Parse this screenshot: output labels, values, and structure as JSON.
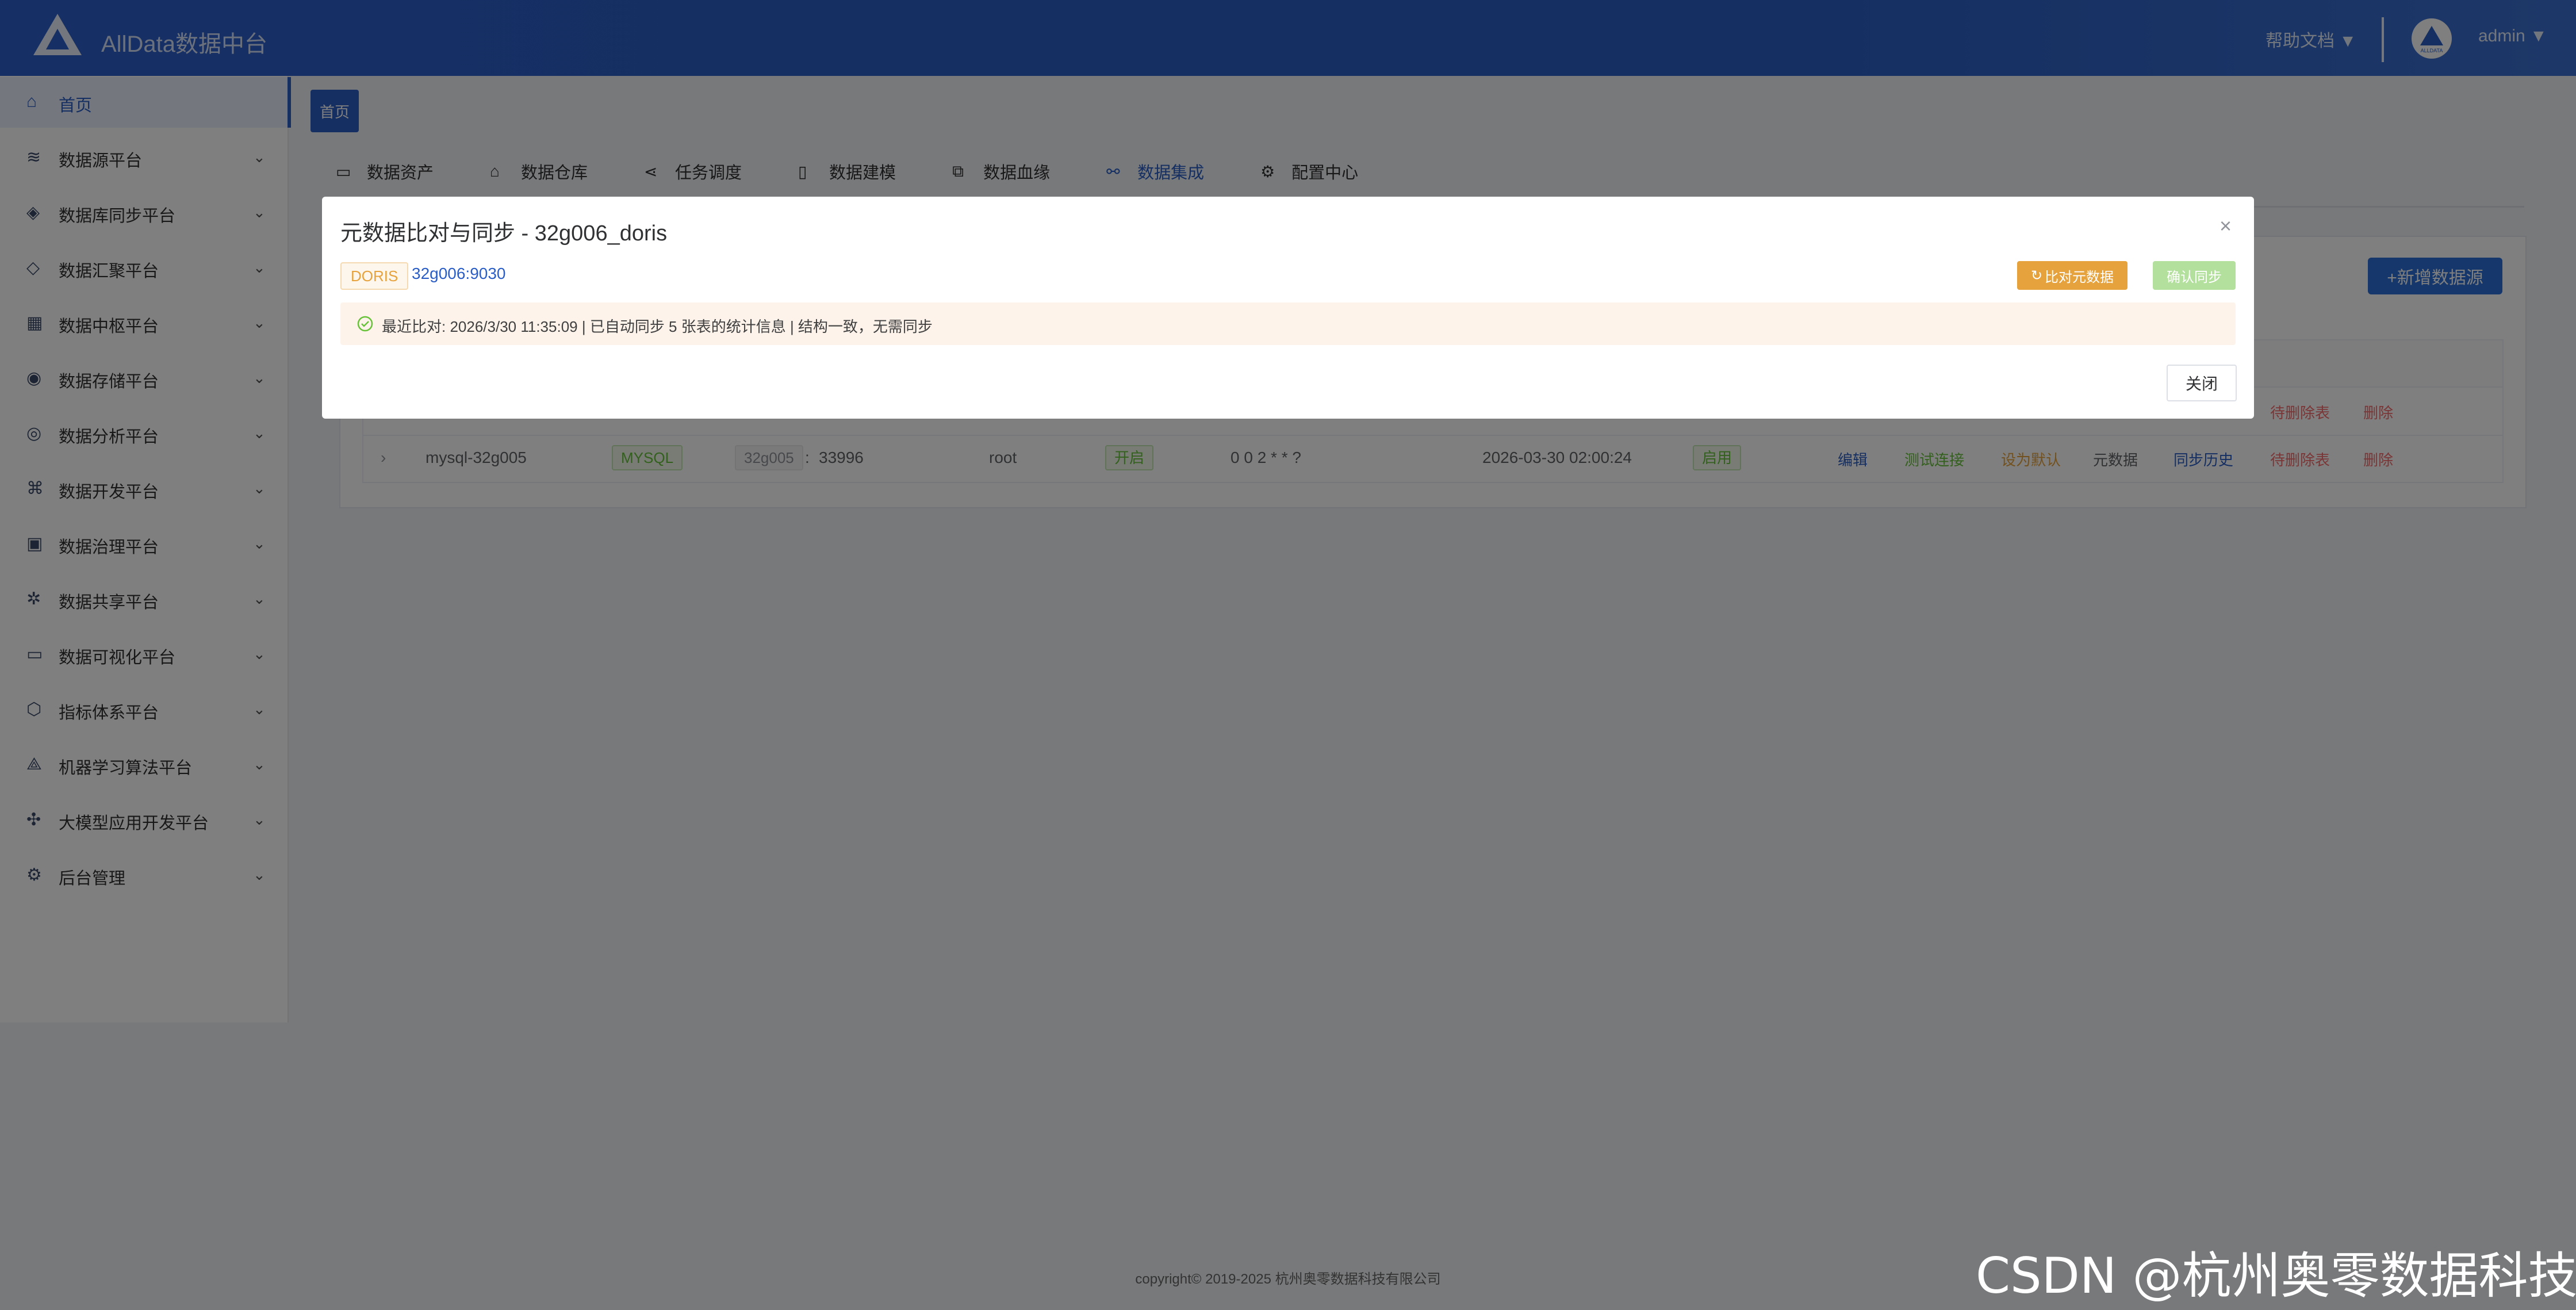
{
  "header": {
    "app_title": "AllData数据中台",
    "help": "帮助文档 ▼",
    "user": "admin ▼",
    "avatar_text": "ALLDATA"
  },
  "sidebar": {
    "items": [
      {
        "label": "首页",
        "icon": "home-icon"
      },
      {
        "label": "数据源平台",
        "icon": "database-icon"
      },
      {
        "label": "数据库同步平台",
        "icon": "shield-sync-icon"
      },
      {
        "label": "数据汇聚平台",
        "icon": "layers-icon"
      },
      {
        "label": "数据中枢平台",
        "icon": "blocks-icon"
      },
      {
        "label": "数据存储平台",
        "icon": "storage-chart-icon"
      },
      {
        "label": "数据分析平台",
        "icon": "analytics-icon"
      },
      {
        "label": "数据开发平台",
        "icon": "dev-icon"
      },
      {
        "label": "数据治理平台",
        "icon": "governance-icon"
      },
      {
        "label": "数据共享平台",
        "icon": "share-icon"
      },
      {
        "label": "数据可视化平台",
        "icon": "monitor-icon"
      },
      {
        "label": "指标体系平台",
        "icon": "cube-icon"
      },
      {
        "label": "机器学习算法平台",
        "icon": "ml-icon"
      },
      {
        "label": "大模型应用开发平台",
        "icon": "llm-icon"
      },
      {
        "label": "后台管理",
        "icon": "settings-icon"
      }
    ]
  },
  "breadcrumb": {
    "home": "首页"
  },
  "topnav": {
    "items": [
      {
        "label": "数据资产",
        "icon": "asset-icon",
        "active": false
      },
      {
        "label": "数据仓库",
        "icon": "warehouse-icon",
        "active": false
      },
      {
        "label": "任务调度",
        "icon": "share-nodes-icon",
        "active": false
      },
      {
        "label": "数据建模",
        "icon": "model-icon",
        "active": false
      },
      {
        "label": "数据血缘",
        "icon": "lineage-icon",
        "active": false
      },
      {
        "label": "数据集成",
        "icon": "link-icon",
        "active": true
      },
      {
        "label": "配置中心",
        "icon": "gear-icon",
        "active": false
      }
    ]
  },
  "page": {
    "add_button": "+新增数据源"
  },
  "table": {
    "row1": {
      "actions": [
        "待删除表",
        "删除"
      ]
    },
    "row2": {
      "name": "mysql-32g005",
      "type": "MYSQL",
      "host": "32g005",
      "port": "33996",
      "user": "root",
      "status": "开启",
      "cron": "0 0 2 * * ?",
      "time": "2026-03-30 02:00:24",
      "state": "启用",
      "actions": [
        "编辑",
        "测试连接",
        "设为默认",
        "元数据",
        "同步历史",
        "待删除表",
        "删除"
      ]
    }
  },
  "modal": {
    "title": "元数据比对与同步 - 32g006_doris",
    "db_type": "DORIS",
    "host": "32g006:9030",
    "compare_button": "比对元数据",
    "confirm_button": "确认同步",
    "alert_text": "最近比对: 2026/3/30 11:35:09 | 已自动同步 5 张表的统计信息 | 结构一致，无需同步",
    "close_button": "关闭"
  },
  "footer": {
    "text": "copyright© 2019-2025 杭州奥零数据科技有限公司"
  },
  "watermark": "CSDN @杭州奥零数据科技",
  "colors": {
    "primary": "#2a5ec6",
    "warning": "#e6a23c",
    "success": "#67c23a",
    "danger": "#f56c6c"
  }
}
